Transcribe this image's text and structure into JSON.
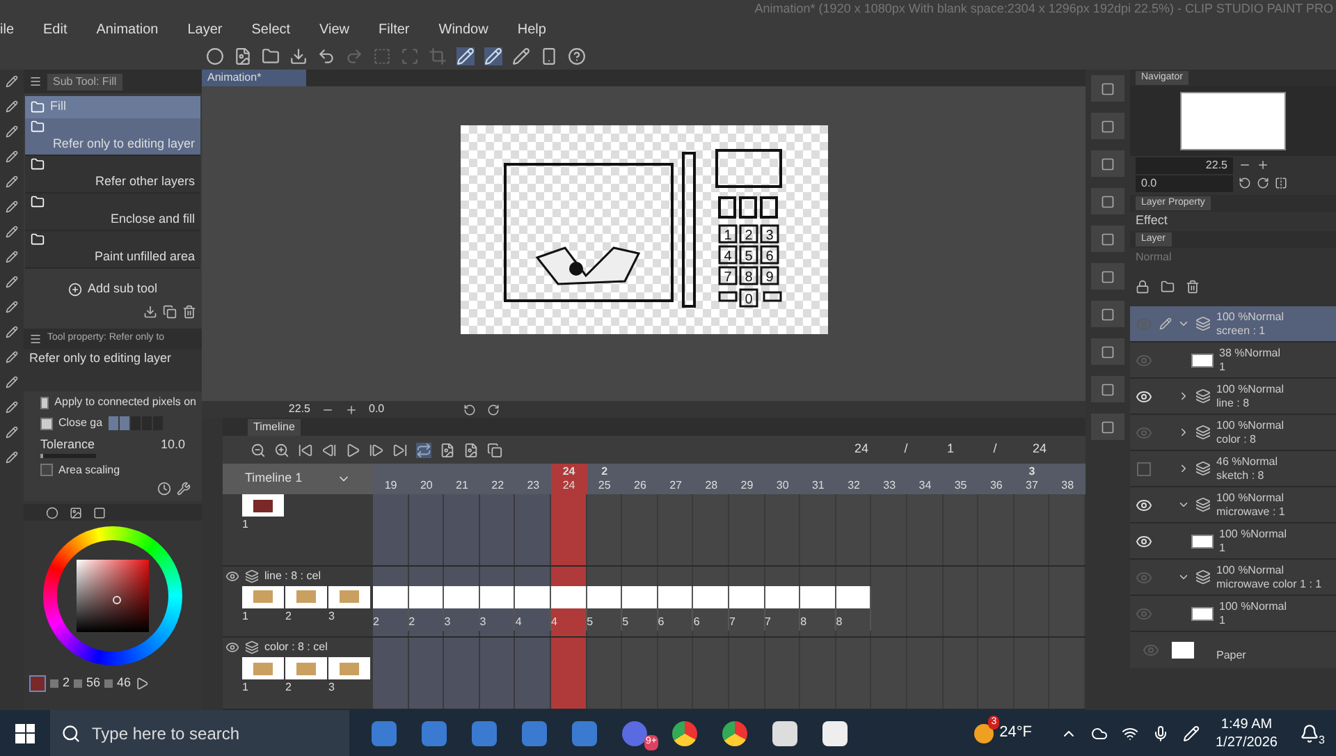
{
  "title_bar": {
    "title": "Animation* (1920 x 1080px With blank space:2304 x 1296px 192dpi 22.5%) - CLIP STUDIO PAINT PRO"
  },
  "menu": [
    "ile",
    "Edit",
    "Animation",
    "Layer",
    "Select",
    "View",
    "Filter",
    "Window",
    "Help"
  ],
  "sub_tool": {
    "title": "Sub Tool: Fill",
    "group": "Fill",
    "add_label": "Add sub tool",
    "items": [
      {
        "label": "Refer only to editing layer",
        "selected": true
      },
      {
        "label": "Refer other layers",
        "selected": false
      },
      {
        "label": "Enclose and fill",
        "selected": false
      },
      {
        "label": "Paint unfilled area",
        "selected": false
      }
    ]
  },
  "tool_property": {
    "title": "Tool property: Refer only to",
    "tool_name": "Refer only to editing layer",
    "options": [
      {
        "kind": "checkbox",
        "label": "Apply to connected pixels on",
        "checked": true
      },
      {
        "kind": "steps",
        "label": "Close ga",
        "checked": true,
        "level": 0.4
      },
      {
        "kind": "value",
        "label": "Tolerance",
        "value": "10.0",
        "level": 0.05
      },
      {
        "kind": "checkbox",
        "label": "Area scaling",
        "checked": false
      }
    ]
  },
  "color": {
    "values": [
      "2",
      "56",
      "46"
    ]
  },
  "canvas": {
    "tab": "Animation*",
    "keypad": [
      "1",
      "2",
      "3",
      "4",
      "5",
      "6",
      "7",
      "8",
      "9",
      "0"
    ],
    "zoom": "22.5",
    "rotation": "0.0"
  },
  "timeline": {
    "title": "Timeline",
    "name": "Timeline 1",
    "counter": [
      "24",
      "/",
      "1",
      "/",
      "24"
    ],
    "frames": [
      {
        "label": "19",
        "selected": false
      },
      {
        "label": "20",
        "selected": false
      },
      {
        "label": "21",
        "selected": false
      },
      {
        "label": "22",
        "selected": false
      },
      {
        "label": "23",
        "selected": false
      },
      {
        "label": "24",
        "selected": true,
        "marker": "24"
      },
      {
        "label": "25",
        "selected": false,
        "marker": "2"
      },
      {
        "label": "26",
        "selected": false
      },
      {
        "label": "27",
        "selected": false
      },
      {
        "label": "28",
        "selected": false
      },
      {
        "label": "29",
        "selected": false
      },
      {
        "label": "30",
        "selected": false
      },
      {
        "label": "31",
        "selected": false
      },
      {
        "label": "32",
        "selected": false
      },
      {
        "label": "33",
        "selected": false
      },
      {
        "label": "34",
        "selected": false
      },
      {
        "label": "35",
        "selected": false
      },
      {
        "label": "36",
        "selected": false
      },
      {
        "label": "37",
        "selected": false,
        "marker": "3"
      },
      {
        "label": "38",
        "selected": false
      }
    ],
    "tracks": [
      {
        "thumbs": [
          "1"
        ]
      },
      {
        "name": "line : 8 : cel",
        "thumbs": [
          "1",
          "2",
          "3"
        ],
        "cells": [
          "2",
          "2",
          "3",
          "3",
          "4",
          "4",
          "5",
          "5",
          "6",
          "6",
          "7",
          "7",
          "8",
          "8"
        ]
      },
      {
        "name": "color : 8 : cel",
        "thumbs": [
          "1",
          "2",
          "3"
        ]
      }
    ]
  },
  "navigator": {
    "title": "Navigator",
    "zoom": "22.5",
    "rotation": "0.0"
  },
  "layer_property": {
    "title": "Layer Property",
    "effect": "Effect"
  },
  "layers": {
    "title": "Layer",
    "blend": "Normal",
    "layers": [
      {
        "mode": "100 %Normal",
        "name": "screen : 1",
        "visible": false,
        "selected": true,
        "expanded": true,
        "children": [
          {
            "mode": "38 %Normal",
            "name": "1",
            "visible": false
          }
        ]
      },
      {
        "mode": "100 %Normal",
        "name": "line : 8",
        "visible": true,
        "selected": false,
        "expanded": false
      },
      {
        "mode": "100 %Normal",
        "name": "color : 8",
        "visible": false,
        "selected": false,
        "expanded": false
      },
      {
        "mode": "46 %Normal",
        "name": "sketch : 8",
        "visible": false,
        "eye_icon": false,
        "selected": false,
        "expanded": false
      },
      {
        "mode": "100 %Normal",
        "name": "microwave : 1",
        "visible": true,
        "selected": false,
        "expanded": true,
        "children": [
          {
            "mode": "100 %Normal",
            "name": "1",
            "visible": true
          }
        ]
      },
      {
        "mode": "100 %Normal",
        "name": "microwave color 1 : 1",
        "visible": false,
        "selected": false,
        "expanded": true,
        "children": [
          {
            "mode": "100 %Normal",
            "name": "1",
            "visible": false
          }
        ]
      }
    ],
    "paper": {
      "name": "Paper",
      "visible": false
    }
  },
  "taskbar": {
    "search": "Type here to search",
    "chrome_badge": "9+",
    "weather_badge": "3",
    "weather": "24°F",
    "time": "1:49 AM",
    "date": "1/27/2026",
    "notifications": "3"
  }
}
